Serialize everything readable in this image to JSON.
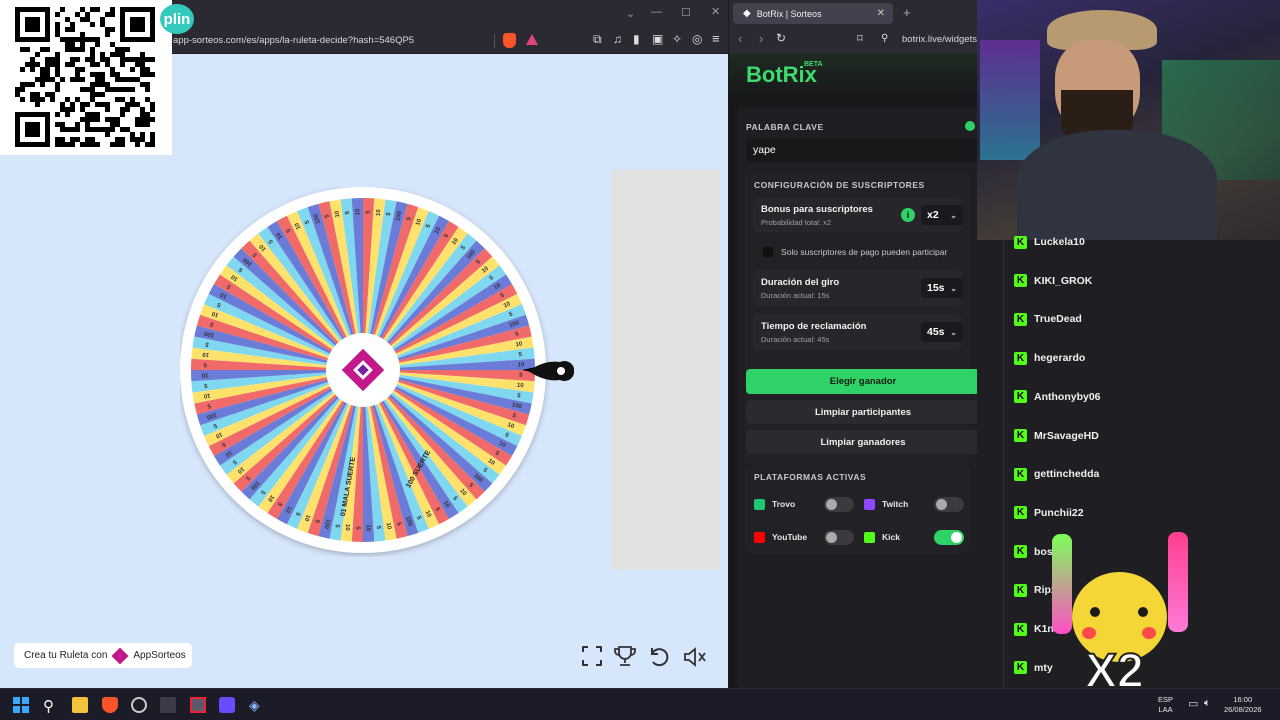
{
  "left_browser": {
    "url": "app-sorteos.com/es/apps/la-ruleta-decide?hash=546QP5",
    "qr_overlay": "QR code",
    "plin_badge": "plin",
    "wheel": {
      "segment_colors": [
        "#f06a6a",
        "#ffe26b",
        "#7fd7f0",
        "#6b7bd8"
      ],
      "segment_labels": [
        "5",
        "10",
        "5",
        "100",
        "5",
        "10",
        "5",
        "10"
      ],
      "center_icon": "appsorteos-logo-icon",
      "pointer_icon": "wheel-pointer-icon",
      "bottom_labels": [
        "01 MALA SUERTE",
        "100 SUERTE"
      ]
    },
    "create_badge": {
      "text": "Crea tu Ruleta con",
      "brand": "AppSorteos"
    },
    "toolbar_icons": [
      "fullscreen-icon",
      "trophy-icon",
      "reset-icon",
      "volume-icon"
    ]
  },
  "mid_browser": {
    "tab_title": "BotRix | Sorteos",
    "url": "botrix.live/widgets",
    "logo": "BotRix",
    "logo_badge": "BETA",
    "keyword_label": "PALABRA CLAVE",
    "keyword_value": "yape",
    "subs_section": "CONFIGURACIÓN DE SUSCRIPTORES",
    "bonus": {
      "title": "Bonus para suscriptores",
      "sub": "Probabilidad total: x2",
      "value": "x2"
    },
    "paid_only": "Solo suscriptores de pago pueden participar",
    "spin": {
      "title": "Duración del giro",
      "sub": "Duración actual: 15s",
      "value": "15s"
    },
    "claim": {
      "title": "Tiempo de reclamación",
      "sub": "Duración actual: 45s",
      "value": "45s"
    },
    "buttons": {
      "pick": "Elegir ganador",
      "clear_participants": "Limpiar participantes",
      "clear_winners": "Limpiar ganadores"
    },
    "platforms_label": "PLATAFORMAS ACTIVAS",
    "platforms": [
      {
        "name": "Trovo",
        "on": false,
        "color": "#1ec66f"
      },
      {
        "name": "Twitch",
        "on": false,
        "color": "#9146ff"
      },
      {
        "name": "YouTube",
        "on": false,
        "color": "#ff0000"
      },
      {
        "name": "Kick",
        "on": true,
        "color": "#53fc18"
      }
    ],
    "accent": "#2fd266"
  },
  "participants": [
    "Luckela10",
    "KIKI_GROK",
    "TrueDead",
    "hegerardo",
    "Anthonyby06",
    "MrSavageHD",
    "gettinchedda",
    "Punchii22",
    "bos",
    "Ripx",
    "K1n",
    "mty"
  ],
  "sticker_text": "X2",
  "taskbar": {
    "lang_top": "ESP",
    "lang_bottom": "LAA",
    "time": "16:00",
    "date": "26/08/2026"
  }
}
